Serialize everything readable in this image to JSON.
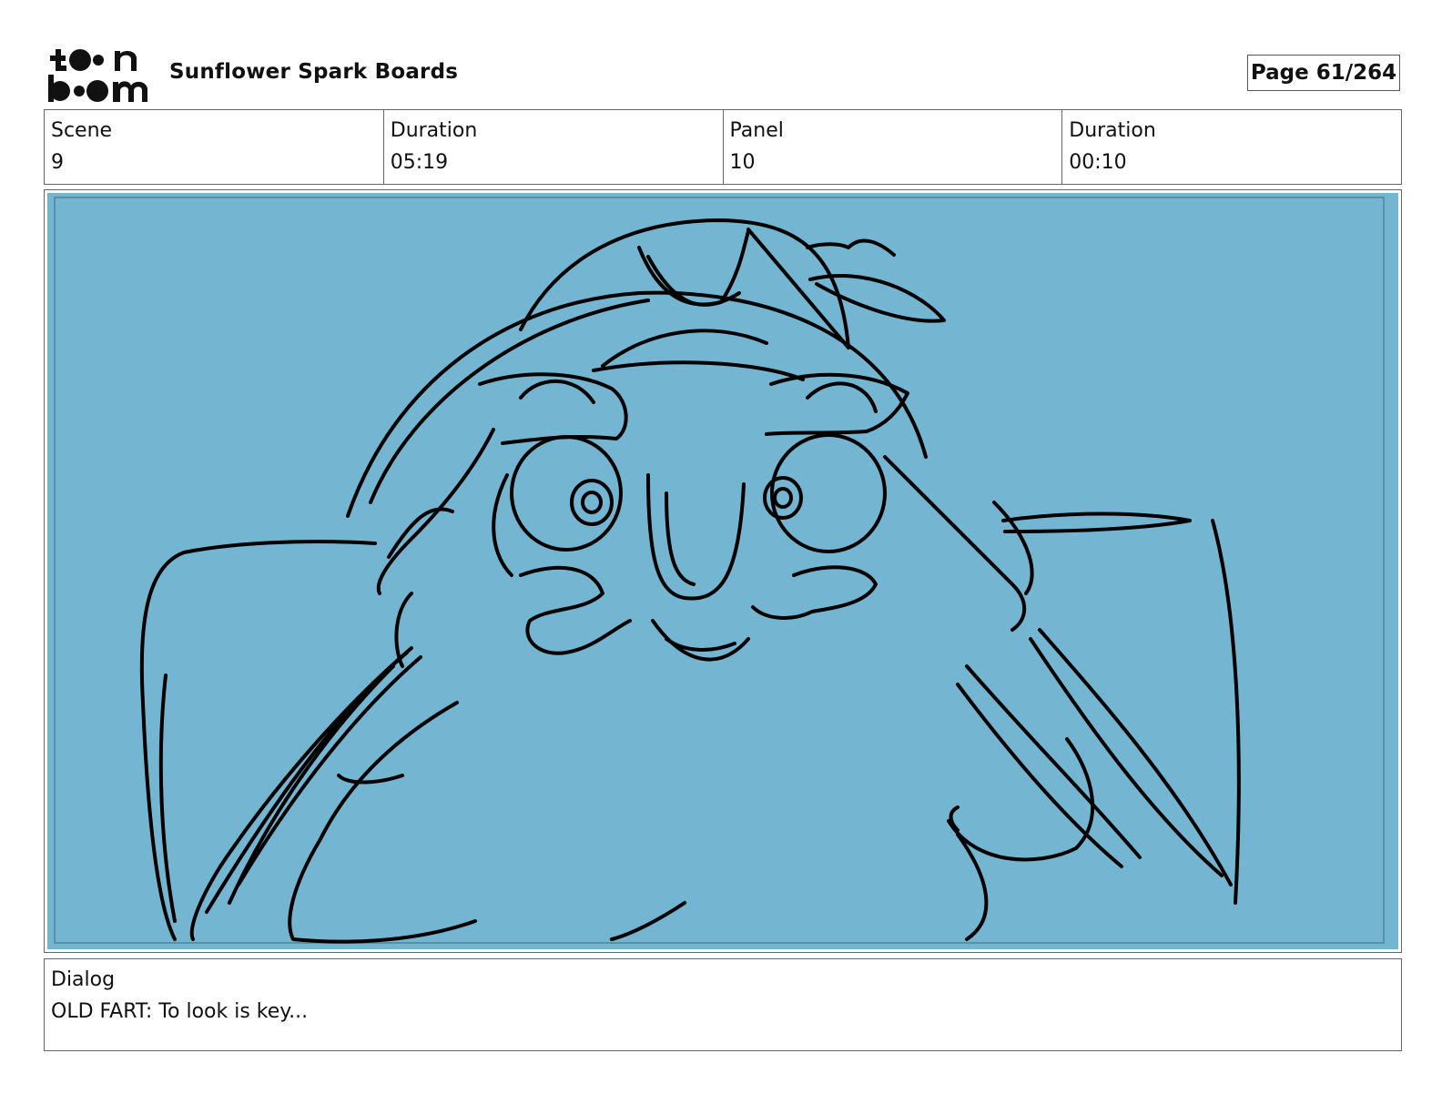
{
  "header": {
    "logo_text_top": "toon",
    "logo_text_bottom": "boom",
    "project_title": "Sunflower Spark Boards",
    "page_label": "Page  61/264"
  },
  "info": [
    {
      "label": "Scene",
      "value": "9"
    },
    {
      "label": "Duration",
      "value": "05:19"
    },
    {
      "label": "Panel",
      "value": "10"
    },
    {
      "label": "Duration",
      "value": "00:10"
    }
  ],
  "panel": {
    "background_color": "#74b5d2",
    "border_color": "#5b8fa6",
    "line_color": "#000000"
  },
  "dialog": {
    "label": "Dialog",
    "text": "OLD FART: To look is key..."
  }
}
